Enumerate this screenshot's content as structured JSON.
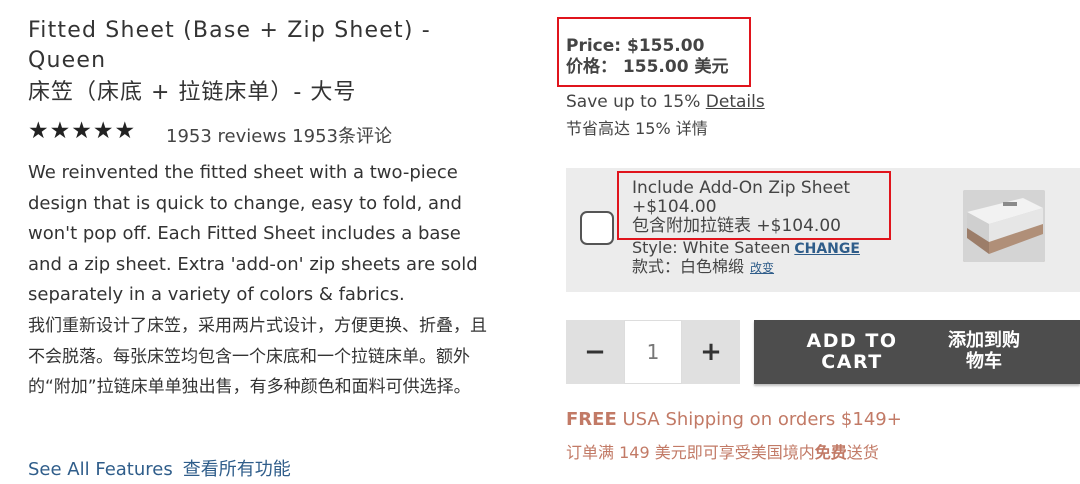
{
  "product": {
    "title_en": "Fitted Sheet (Base + Zip Sheet) - Queen",
    "title_zh": "床笠（床底 + 拉链床单）- 大号",
    "stars": "★★★★★",
    "reviews_en": "1953 reviews",
    "reviews_zh": "1953条评论",
    "description_en": "We reinvented the fitted sheet with a two-piece design that is quick to change, easy to fold, and won't pop off. Each Fitted Sheet includes a base and a zip sheet. Extra 'add-on' zip sheets are sold separately in a variety of colors & fabrics.",
    "description_zh": "我们重新设计了床笠，采用两片式设计，方便更换、折叠，且不会脱落。每张床笠均包含一个床底和一个拉链床单。额外的“附加”拉链床单单独出售，有多种颜色和面料可供选择。",
    "features_en": "See All Features",
    "features_zh": "查看所有功能"
  },
  "pricing": {
    "price_en": "Price: $155.00",
    "price_zh": "价格：  155.00 美元",
    "save_en": "Save up to 15%",
    "details_link": "Details",
    "save_zh": "节省高达 15% 详情"
  },
  "addon": {
    "title_en": "Include Add-On Zip Sheet",
    "price_en": "+$104.00",
    "title_zh": "包含附加拉链表 +$104.00",
    "style_en": "Style: White Sateen",
    "change_en": "CHANGE",
    "style_zh": "款式：白色棉缎",
    "change_zh": "改变",
    "checked": false
  },
  "cart": {
    "minus": "−",
    "quantity": "1",
    "plus": "+",
    "add_en": "ADD TO CART",
    "add_zh": "添加到购物车"
  },
  "shipping": {
    "free_en": "FREE",
    "text_en": " USA Shipping on orders $149+",
    "zh_pre": "订单满 149 美元即可享受美国境内",
    "zh_bold": "免费",
    "zh_post": "送货"
  },
  "colors": {
    "highlight_border": "#e0141c",
    "link_blue": "#2f5d8a",
    "shipping_text": "#c27a66",
    "button_bg": "#4d4d4d"
  }
}
